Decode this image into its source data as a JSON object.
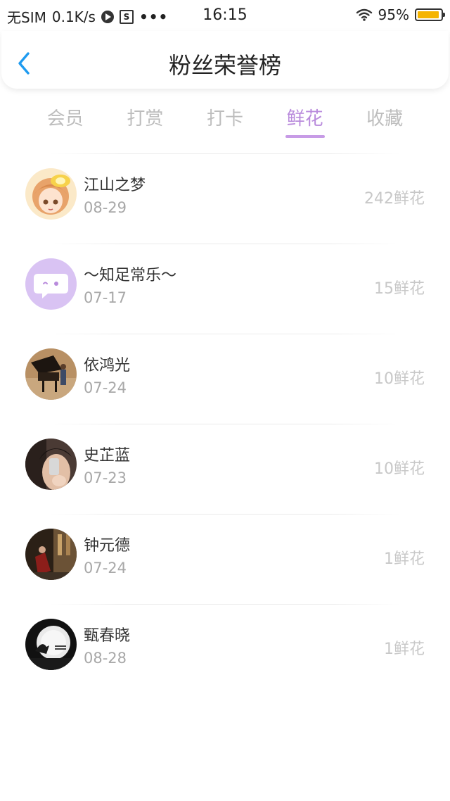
{
  "status_bar": {
    "carrier": "无SIM",
    "speed": "0.1K/s",
    "dots": "•••",
    "time": "16:15",
    "battery_pct_label": "95%",
    "battery_level": 0.95,
    "battery_color": "#f5b400"
  },
  "header": {
    "back_icon": "chevron-left-icon",
    "title": "粉丝荣誉榜"
  },
  "tabs": [
    {
      "label": "会员",
      "active": false
    },
    {
      "label": "打赏",
      "active": false
    },
    {
      "label": "打卡",
      "active": false
    },
    {
      "label": "鲜花",
      "active": true
    },
    {
      "label": "收藏",
      "active": false
    }
  ],
  "colors": {
    "accent": "#b98bdc",
    "back_arrow": "#1e9bf0"
  },
  "fans": [
    {
      "name": "江山之梦",
      "date": "08-29",
      "count": "242鲜花",
      "avatar": "anime-girl-avatar"
    },
    {
      "name": "～知足常乐～",
      "date": "07-17",
      "count": "15鲜花",
      "avatar": "chat-bubble-avatar"
    },
    {
      "name": "依鸿光",
      "date": "07-24",
      "count": "10鲜花",
      "avatar": "piano-photo-avatar"
    },
    {
      "name": "史芷蓝",
      "date": "07-23",
      "count": "10鲜花",
      "avatar": "selfie-photo-avatar"
    },
    {
      "name": "钟元德",
      "date": "07-24",
      "count": "1鲜花",
      "avatar": "street-photo-avatar"
    },
    {
      "name": "甄春晓",
      "date": "08-28",
      "count": "1鲜花",
      "avatar": "moon-night-avatar"
    }
  ]
}
